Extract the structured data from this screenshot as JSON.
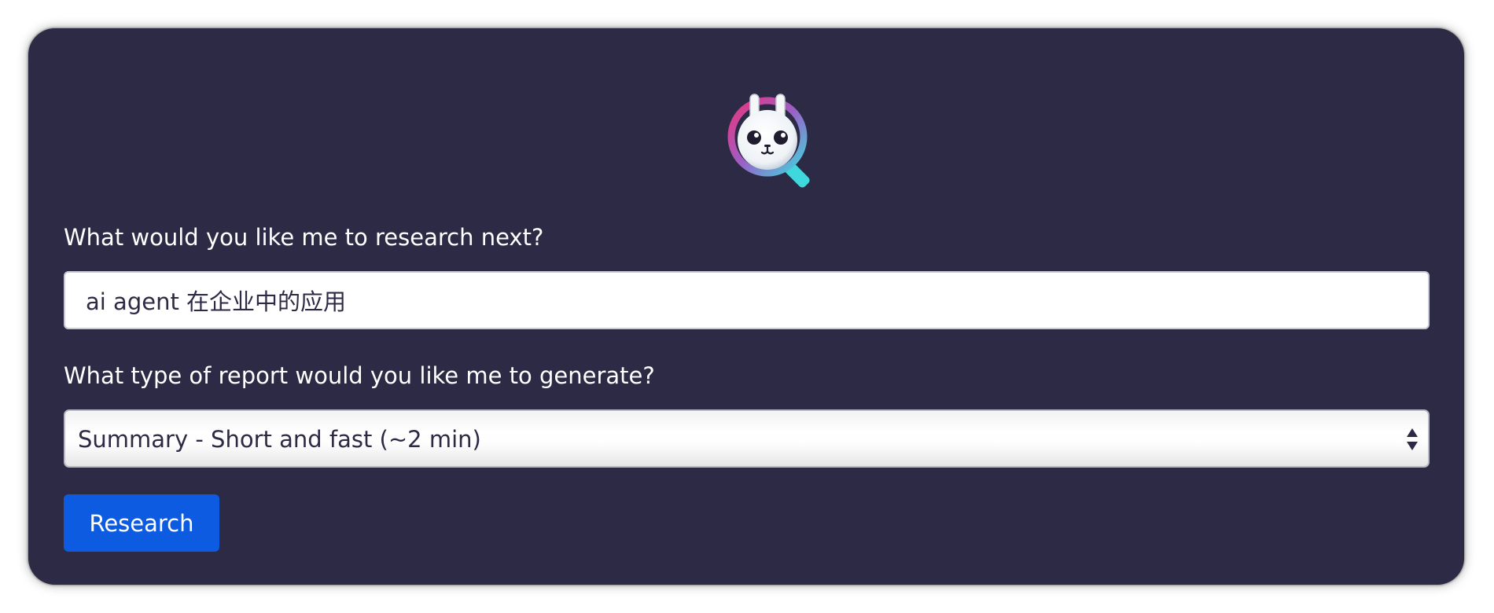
{
  "research_form": {
    "query_label": "What would you like me to research next?",
    "query_value": "ai agent 在企业中的应用",
    "report_type_label": "What type of report would you like me to generate?",
    "report_type_selected": "Summary - Short and fast (~2 min)",
    "submit_label": "Research"
  },
  "logo": {
    "icon": "bunny-magnifier-logo-icon"
  },
  "colors": {
    "card_background": "#2d2a45",
    "button_background": "#0d5be1",
    "text_light": "#ffffff",
    "text_dark": "#2d2a45",
    "logo_pink": "#e8357c",
    "logo_cyan": "#3fd8dd"
  }
}
